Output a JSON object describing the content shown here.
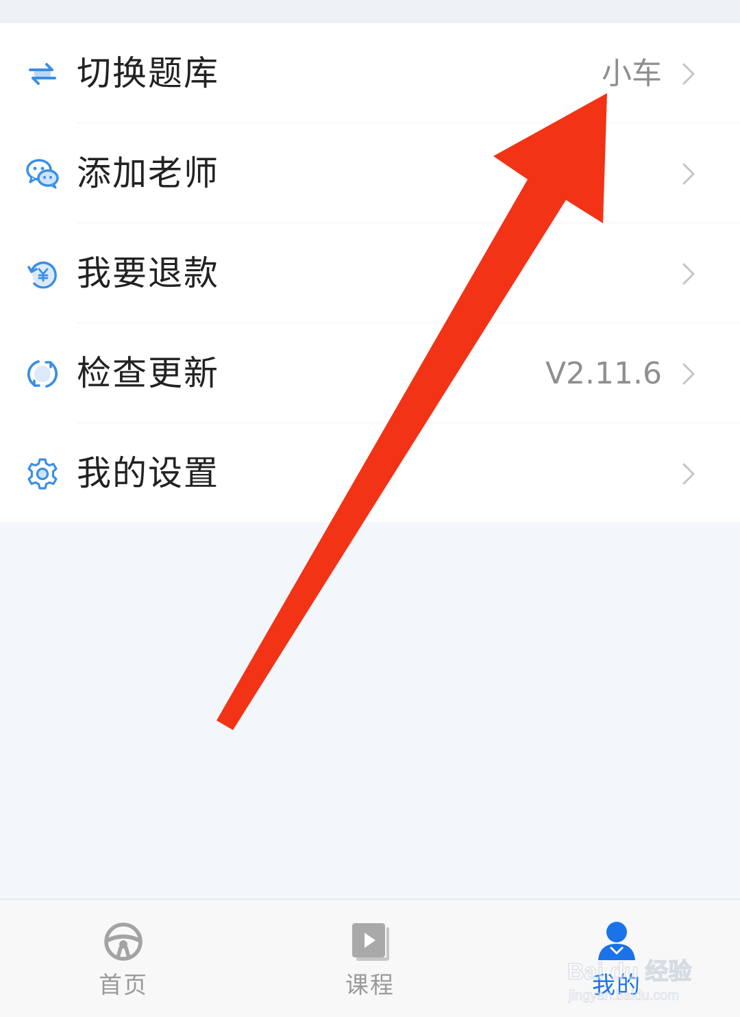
{
  "menu": {
    "items": [
      {
        "label": "切换题库",
        "value": "小车",
        "icon": "swap-icon"
      },
      {
        "label": "添加老师",
        "value": "",
        "icon": "wechat-icon"
      },
      {
        "label": "我要退款",
        "value": "",
        "icon": "refund-icon"
      },
      {
        "label": "检查更新",
        "value": "V2.11.6",
        "icon": "refresh-icon"
      },
      {
        "label": "我的设置",
        "value": "",
        "icon": "gear-icon"
      }
    ]
  },
  "tabbar": {
    "tabs": [
      {
        "label": "首页",
        "icon": "steering-wheel-icon",
        "active": false
      },
      {
        "label": "课程",
        "icon": "video-book-icon",
        "active": false
      },
      {
        "label": "我的",
        "icon": "user-icon",
        "active": true
      }
    ]
  },
  "watermark": {
    "text": "Bai du 经验",
    "url": "jingyan.baidu.com"
  },
  "colors": {
    "accent": "#1a73e8",
    "icon_blue": "#3a8ee6",
    "arrow_red": "#f23316",
    "background": "#f3f6fa",
    "tab_inactive": "#9a9a9a"
  }
}
